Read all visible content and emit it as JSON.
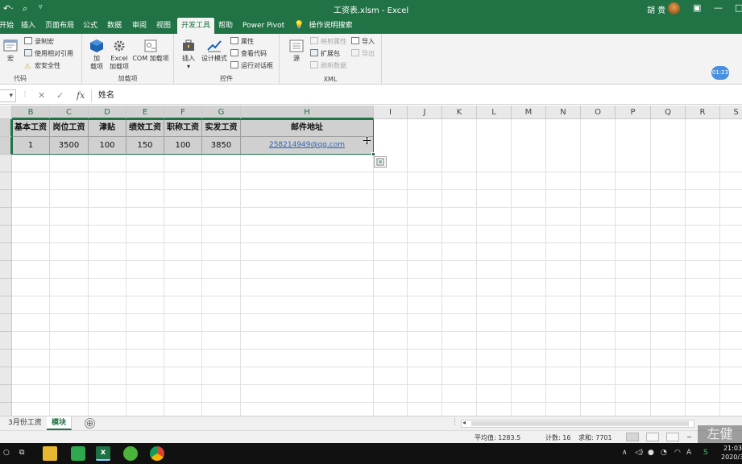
{
  "titlebar": {
    "title": "工资表.xlsm - Excel",
    "user": "胡 贵",
    "undo_icon": "undo-icon",
    "preview_icon": "print-preview-icon",
    "customize_icon": "customize-qat-icon"
  },
  "tabs": [
    {
      "label": "开始"
    },
    {
      "label": "插入"
    },
    {
      "label": "页面布局"
    },
    {
      "label": "公式"
    },
    {
      "label": "数据"
    },
    {
      "label": "审阅"
    },
    {
      "label": "视图"
    },
    {
      "label": "开发工具",
      "active": true
    },
    {
      "label": "帮助"
    },
    {
      "label": "Power Pivot"
    },
    {
      "label": "操作说明搜索"
    }
  ],
  "ribbon": {
    "code": {
      "label": "代码",
      "macro": "宏",
      "record": "录制宏",
      "relative": "使用相对引用",
      "security": "宏安全性"
    },
    "addins": {
      "label": "加载项",
      "addin_line1": "加",
      "addin_line2": "载项",
      "excel_line1": "Excel",
      "excel_line2": "加载项",
      "com": "COM 加载项"
    },
    "controls": {
      "label": "控件",
      "insert": "插入",
      "design_mode": "设计模式",
      "properties": "属性",
      "view_code": "查看代码",
      "run_dialog": "运行对话框"
    },
    "xml": {
      "label": "XML",
      "source": "源",
      "map_props": "映射属性",
      "expansion": "扩展包",
      "refresh": "刷新数据",
      "import": "导入",
      "export": "导出"
    }
  },
  "timer": "01:23",
  "formula_bar": {
    "namebox": "▾",
    "cancel": "✕",
    "enter": "✓",
    "fx": "fx",
    "value": "姓名"
  },
  "grid": {
    "columns": [
      "B",
      "C",
      "D",
      "E",
      "F",
      "G",
      "H",
      "I",
      "J",
      "K",
      "L",
      "M",
      "N",
      "O",
      "P",
      "Q",
      "R",
      "S"
    ],
    "header_row": [
      "基本工资",
      "岗位工资",
      "津贴",
      "绩效工资",
      "职称工资",
      "实发工资",
      "邮件地址"
    ],
    "data_row": [
      "1",
      "3500",
      "100",
      "150",
      "100",
      "3850",
      "258214949@qq.com"
    ]
  },
  "sheets": [
    {
      "label": "3月份工资"
    },
    {
      "label": "模块",
      "active": true
    }
  ],
  "add_sheet": "⊕",
  "status": {
    "average": "平均值: 1283.5",
    "count": "计数: 16",
    "sum": "求和: 7701"
  },
  "watermark": "左健",
  "clock": {
    "time": "21:03",
    "date": "2020/3/"
  },
  "colors": {
    "accent": "#217346",
    "link": "#2f62b4",
    "selected_fill": "#d0d0d0"
  }
}
